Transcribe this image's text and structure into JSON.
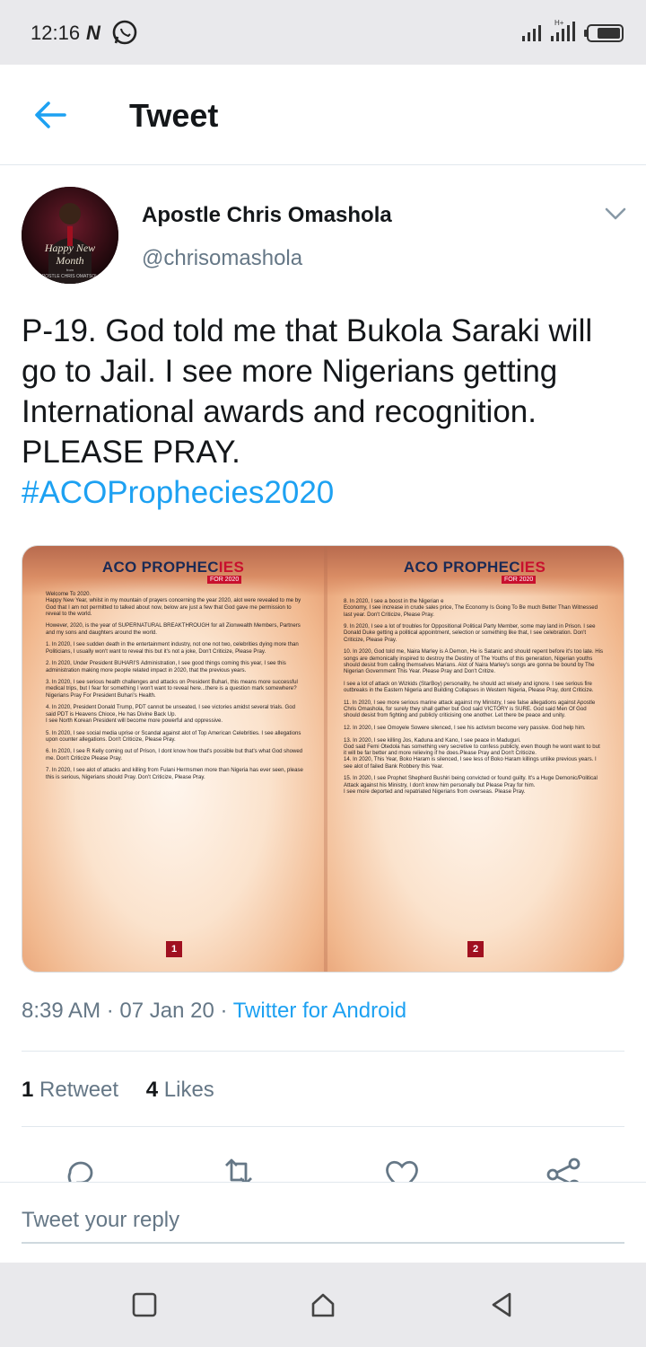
{
  "status_bar": {
    "time": "12:16",
    "notification_icons": [
      "n-icon",
      "whatsapp-icon"
    ],
    "right_icons": [
      "signal-icon",
      "dual-sim-signal-icon",
      "battery-icon"
    ]
  },
  "app_bar": {
    "back_icon": "arrow-left-icon",
    "title": "Tweet"
  },
  "author": {
    "name": "Apostle Chris Omashola",
    "handle": "@chrisomashola",
    "avatar_text_1": "Happy New",
    "avatar_text_2": "Month",
    "avatar_text_3": "from",
    "avatar_text_4": "APOSTLE CHRIS OMATSOLA",
    "menu_icon": "chevron-down-icon"
  },
  "tweet": {
    "text": "P-19. God told me that Bukola Saraki will go to Jail. I see more Nigerians getting International awards and recognition. PLEASE PRAY.",
    "hashtag": "#ACOProphecies2020"
  },
  "media": {
    "left_page": {
      "title_prefix": "ACO ",
      "title_main": "PROPHEC",
      "title_suffix": "IES",
      "badge": "FOR 2020",
      "page_number": "1",
      "paragraphs": [
        "Welcome To 2020.\nHappy New Year, whilst in my mountain of prayers concerning the year 2020, alot were revealed to me by God that I am not permitted to talked about now, below are just a few that God gave me permission to reveal to the world.",
        "However, 2020, is the year of SUPERNATURAL BREAKTHROUGH for all Zionwealth Members, Partners and my sons and daughters around the world.",
        "1. In 2020, I see sudden death in the entertainment industry, not one not two, celebrities dying more than Politicians, I usually won't want to reveal this but it's not a joke, Don't Criticize, Please Pray.",
        "2. In 2020, Under President BUHARI'S Administration, I see good things coming this year, I see this administration making more people related impact in 2020, that the previous years.",
        "3. In 2020, I see serious health challenges and attacks on President Buhari, this means more successful medical trips, but I fear for something I won't want to reveal here...there is a question mark somewhere? Nigerians Pray For President Buhari's Health.",
        "4. In 2020, President Donald Trump, PDT cannot be unseated, I see victories amidst several trials. God said PDT is Heavens Chioce, He has Divine Back Up.\nI see North Korean President will become more powerful and oppressive.",
        "5. In 2020, I see social media uprise or Scandal against alot of Top American Celebrities. I see allegations upon counter allegations. Don't Criticize, Please Pray.",
        "6. In 2020, I see R Kelly coming out of Prison, I dont know how that's possible but that's what God showed me. Don't Criticize Please Pray.",
        "7. In 2020, I see alot of attacks and killing from Fulani Hermsmen more than Nigeria has ever seen, please this is serious, Nigerians should Pray. Don't Criticize, Please Pray."
      ]
    },
    "right_page": {
      "title_prefix": "ACO ",
      "title_main": "PROPHEC",
      "title_suffix": "IES",
      "badge": "FOR 2020",
      "page_number": "2",
      "paragraphs": [
        "8. In 2020, I see a boost in the Nigerian e\nEconomy, I see increase in crude sales price, The Economy Is Going To Be much Better Than Witnessed last year. Don't Criticize, Please Pray.",
        "9. In 2020, I see a lot of troubles for Oppositional Political Party Member, some may land in Prison. I see Donald Duke getting a political appointment, selection or something like that, I see celebration. Don't Criticize, Please Pray.",
        "10. In 2020, God told me, Naira Marley is A Demon, He is Satanic and should repent before it's too late. His songs are demonically inspired to destroy the Destiny of The Youths of this generation, Nigerian youths should desist from calling themselves Marians. Alot of Naira Marley's songs are gonna be bound by The Nigerian Government This Year. Please Pray and Don't Critize.",
        "I see a lot of attack on Wizkids (StarBoy) personality, he should act wisely and ignore. I see serious fire outbreaks in the Eastern Nigeria and Building Collapses in Western Nigeria, Please Pray, dont Criticize.",
        "11. In 2020, I see more serious marine attack against my Ministry, I see false allegations against Apostle Chris Omashola, for surely they shall gather but God said VICTORY is SURE. God said Men Of God should desist from fighting and publicly criticising one another. Let there be peace and unity.",
        "12. In 2020, I see Omoyele Sowere silenced, I see his activism become very passive. God help him.",
        "13. In 2020, I see killing Jos, Kaduna and Kano, I see peace in Maduguri.\nGod said Femi Otedola has something very secretive to confess publicly, even though he wont want to but it will be far better and more relieving if he does.Please Pray and Don't Criticize.\n14. In 2020, This Year, Boko Haram is silenced, I see less of Boko Haram killings unlike previous years. I see alot of failed Bank Robbery this Year.",
        "15. In 2020, I see Prophet Shepherd Bushiri being convicted or found guilty. It's a Huge Demonic/Political Attack against his Ministry, I don't know him personally but Please Pray for him.\nI see more deported and repatriated Nigerians from overseas. Please Pray."
      ]
    }
  },
  "meta": {
    "time": "8:39 AM",
    "separator1": " · ",
    "date": "07 Jan 20",
    "separator2": " · ",
    "source": "Twitter for Android"
  },
  "stats": {
    "retweets_count": "1",
    "retweets_label": "Retweet",
    "likes_count": "4",
    "likes_label": "Likes"
  },
  "actions": [
    "reply-icon",
    "retweet-icon",
    "like-icon",
    "share-icon"
  ],
  "reply": {
    "placeholder": "Tweet your reply"
  },
  "nav": [
    "recents-icon",
    "home-icon",
    "back-icon"
  ],
  "colors": {
    "accent": "#1da1f2",
    "secondary_text": "#657786",
    "primary_text": "#14171a"
  }
}
